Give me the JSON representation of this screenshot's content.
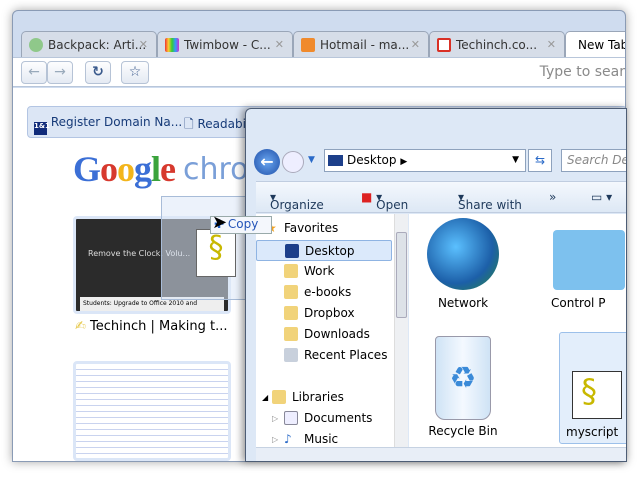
{
  "browser": {
    "tabs": [
      {
        "label": "Backpack: Arti...",
        "color": "#8fc88a"
      },
      {
        "label": "Twimbow - C...",
        "color": "#c04bb8"
      },
      {
        "label": "Hotmail - ma...",
        "color": "#f08a2c"
      },
      {
        "label": "Techinch.co...",
        "color": "#d93025"
      },
      {
        "label": "New Tab",
        "active": true
      }
    ],
    "toolbar": {
      "back": "←",
      "forward": "→",
      "reload": "↻",
      "star": "☆",
      "omnibox_placeholder": "Type to sear"
    },
    "bookmarks": [
      {
        "label": "Register Domain Na..."
      },
      {
        "label": "Readabi"
      }
    ],
    "newtab": {
      "logo_google": "Google",
      "logo_chrome": "chrome",
      "thumbnails": [
        {
          "title": "Techinch | Making t...",
          "preview_heading": "Remove the Clock, Volu...",
          "preview_sub": "Students: Upgrade to Office 2010 and"
        }
      ]
    }
  },
  "drag": {
    "copy_label": "Copy"
  },
  "explorer": {
    "address": "Desktop",
    "search_placeholder": "Search Des",
    "commands": [
      "Organize",
      "Open",
      "Share with",
      "»"
    ],
    "nav": [
      {
        "label": "Favorites",
        "level": 0
      },
      {
        "label": "Desktop",
        "level": 1,
        "selected": true
      },
      {
        "label": "Work",
        "level": 1
      },
      {
        "label": "e-books",
        "level": 1
      },
      {
        "label": "Dropbox",
        "level": 1
      },
      {
        "label": "Downloads",
        "level": 1
      },
      {
        "label": "Recent Places",
        "level": 1
      },
      {
        "label": "Libraries",
        "level": 0
      },
      {
        "label": "Documents",
        "level": 1
      },
      {
        "label": "Music",
        "level": 1
      }
    ],
    "files": [
      {
        "label": "Network"
      },
      {
        "label": "Control P"
      },
      {
        "label": "Recycle Bin"
      },
      {
        "label": "myscript",
        "selected": true
      }
    ]
  }
}
